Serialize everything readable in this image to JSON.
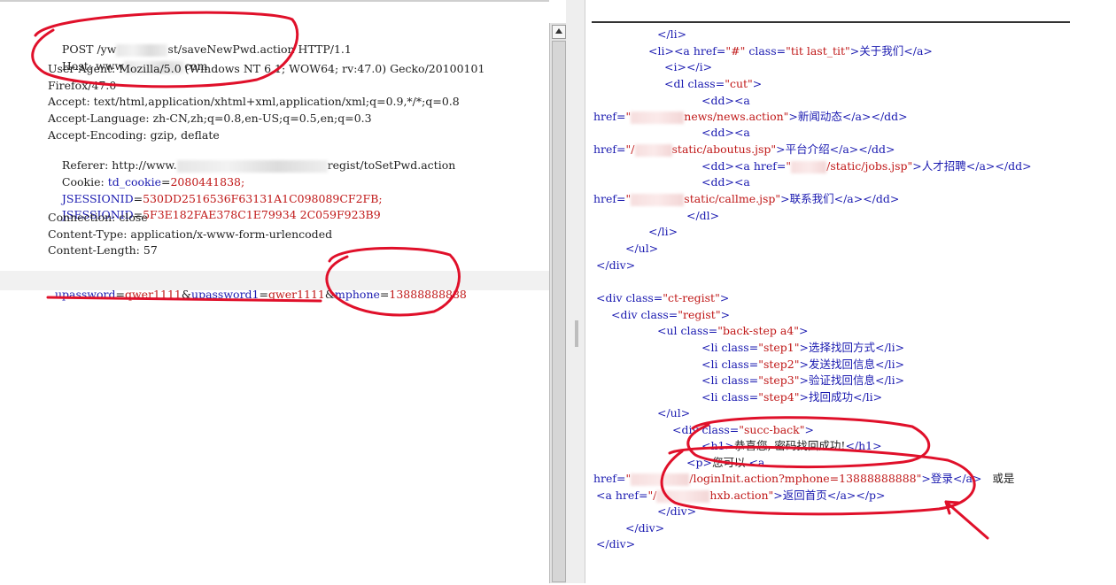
{
  "request": {
    "line1_a": "POST /yw",
    "line1_b": "st/saveNewPwd.action HTTP/1.1",
    "host_a": "Host: www",
    "host_b": "com",
    "ua1": "User-Agent: Mozilla/5.0 (Windows NT 6.1; WOW64; rv:47.0) Gecko/20100101",
    "ua2": "Firefox/47.0",
    "accept": "Accept: text/html,application/xhtml+xml,application/xml;q=0.9,*/*;q=0.8",
    "accept_lang": "Accept-Language: zh-CN,zh;q=0.8,en-US;q=0.5,en;q=0.3",
    "accept_enc": "Accept-Encoding: gzip, deflate",
    "referer_a": "Referer: http://www.",
    "referer_b": "regist/toSetPwd.action",
    "cookie_label": "Cookie: ",
    "cookie_key": "td_cookie",
    "cookie_eq": "=",
    "cookie_val": "2080441838;",
    "jsid1_key": "JSESSIONID",
    "jsid1_eq": "=",
    "jsid1_val": "530DD2516536F63131A1C098089CF2FB;",
    "jsid2_key": "JSESSIONID",
    "jsid2_eq": "=",
    "jsid2_val": "5F3E182FAE378C1E79934 2C059F923B9",
    "connection": "Connection: close",
    "content_type": "Content-Type: application/x-www-form-urlencoded",
    "content_length": "Content-Length: 57",
    "p1_key": "upassword",
    "p1_val": "qwer1111",
    "p2_key": "upassword1",
    "p2_val": "qwer1111",
    "p3_key": "mphone",
    "p3_val": "13888888888",
    "eq": "=",
    "amp": "&"
  },
  "response": {
    "r1": "</li>",
    "r2_a": "<li><a href=",
    "r2_b": "\"#\"",
    "r2_c": " class=",
    "r2_d": "\"tit last_tit\"",
    "r2_e": ">关于我们</a>",
    "r3": "<i></i>",
    "r4_a": "<dl class=",
    "r4_b": "\"cut\"",
    "r4_c": ">",
    "r5": "<dd><a",
    "r6_a": "href=",
    "r6_b": "\"",
    "r6_c": "news/news.action\"",
    "r6_d": ">新闻动态</a></dd>",
    "r7": "<dd><a",
    "r8_a": "href=",
    "r8_b": "\"/",
    "r8_c": "static/aboutus.jsp\"",
    "r8_d": ">平台介绍</a></dd>",
    "r9_a": "<dd><a href=",
    "r9_b": "\"",
    "r9_c": "/static/jobs.jsp\"",
    "r9_d": ">人才招聘</a></dd>",
    "r10": "<dd><a",
    "r11_a": "href=",
    "r11_b": "\"",
    "r11_c": "static/callme.jsp\"",
    "r11_d": ">联系我们</a></dd>",
    "r12": "</dl>",
    "r13": "</li>",
    "r14": "</ul>",
    "r15": "</div>",
    "r16_a": "<div class=",
    "r16_b": "\"ct-regist\"",
    "r16_c": ">",
    "r17_a": "<div class=",
    "r17_b": "\"regist\"",
    "r17_c": ">",
    "r18_a": "<ul class=",
    "r18_b": "\"back-step a4\"",
    "r18_c": ">",
    "r19_a": "<li class=",
    "r19_b": "\"step1\"",
    "r19_c": ">选择找回方式</li>",
    "r20_a": "<li class=",
    "r20_b": "\"step2\"",
    "r20_c": ">发送找回信息</li>",
    "r21_a": "<li class=",
    "r21_b": "\"step3\"",
    "r21_c": ">验证找回信息</li>",
    "r22_a": "<li class=",
    "r22_b": "\"step4\"",
    "r22_c": ">找回成功</li>",
    "r23": "</ul>",
    "r24_a": "<div class=",
    "r24_b": "\"succ-back\"",
    "r24_c": ">",
    "r25_a": "<h1>",
    "r25_b": "恭喜您, 密码找回成功!",
    "r25_c": "</h1>",
    "r26_a": "<p>",
    "r26_b": "您可以",
    "r26_c": "<a",
    "r27_a": "href=",
    "r27_b": "\"",
    "r27_c": "/loginInit.action?mphone=13888888888\"",
    "r27_d": ">登录</a>",
    "r27_e": "或是",
    "r28_a": "<a href=",
    "r28_b": "\"/",
    "r28_c": "hxb.action\"",
    "r28_d": ">返回首页</a></p>",
    "r29": "</div>",
    "r30": "</div>",
    "r31": "</div>"
  },
  "colors": {
    "annotation_red": "#e0102a",
    "key_blue": "#1a1ab0",
    "value_red": "#c01818"
  }
}
